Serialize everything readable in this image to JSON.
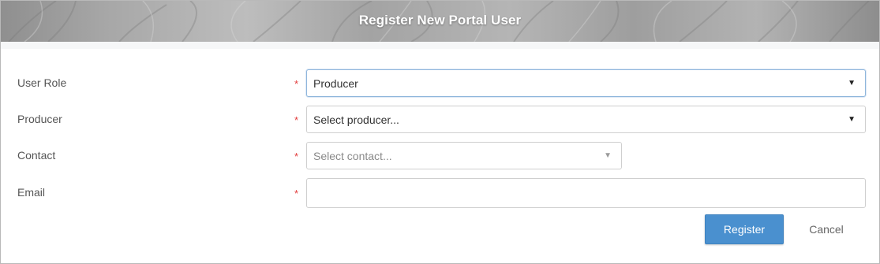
{
  "dialog": {
    "title": "Register New Portal User"
  },
  "form": {
    "required_marker": "*",
    "user_role": {
      "label": "User Role",
      "value": "Producer"
    },
    "producer": {
      "label": "Producer",
      "value": "Select producer..."
    },
    "contact": {
      "label": "Contact",
      "value": "Select contact..."
    },
    "email": {
      "label": "Email",
      "value": ""
    }
  },
  "actions": {
    "register_label": "Register",
    "cancel_label": "Cancel"
  },
  "colors": {
    "primary_button": "#4a90cf",
    "required": "#e23b3b",
    "header_text": "#ffffff"
  },
  "icons": {
    "dropdown": "caret-down-icon"
  }
}
